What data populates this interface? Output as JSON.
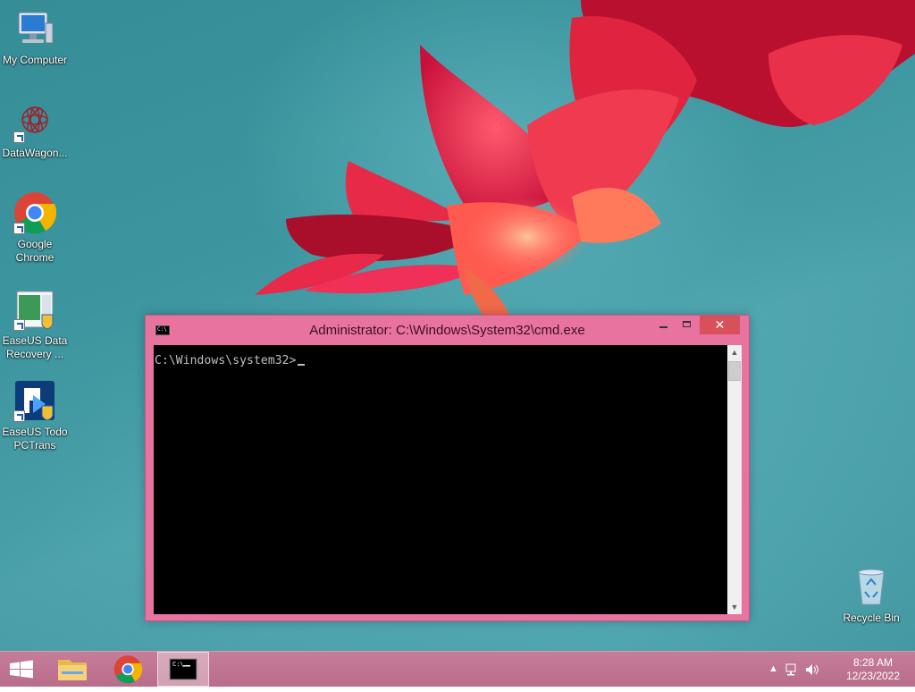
{
  "desktop": {
    "icons": [
      {
        "label": "My Computer",
        "icon": "computer-icon"
      },
      {
        "label": "DataWagon...",
        "icon": "datawagon-icon"
      },
      {
        "label": "Google Chrome",
        "icon": "chrome-icon"
      },
      {
        "label": "EaseUS Data Recovery ...",
        "icon": "easeus-data-recovery-icon"
      },
      {
        "label": "EaseUS Todo PCTrans",
        "icon": "easeus-todo-pctrans-icon"
      },
      {
        "label": "Recycle Bin",
        "icon": "recycle-bin-icon"
      }
    ]
  },
  "cmd": {
    "title": "Administrator: C:\\Windows\\System32\\cmd.exe",
    "prompt": "C:\\Windows\\system32>",
    "close_label": "✕"
  },
  "taskbar": {
    "items": [
      {
        "name": "file-explorer",
        "icon": "folder-icon"
      },
      {
        "name": "google-chrome",
        "icon": "chrome-icon"
      },
      {
        "name": "command-prompt",
        "icon": "cmd-icon",
        "active": true
      }
    ],
    "time": "8:28 AM",
    "date": "12/23/2022"
  },
  "colors": {
    "window_frame": "#e9739f",
    "close_button": "#d8505c",
    "taskbar": "#c67d9a"
  }
}
